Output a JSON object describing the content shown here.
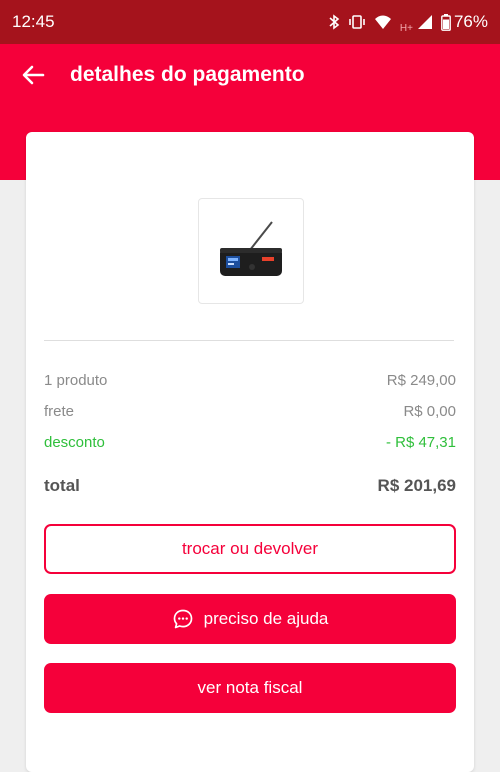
{
  "status_bar": {
    "time": "12:45",
    "network_label": "H+",
    "battery": "76%",
    "icons": [
      "bluetooth-icon",
      "vibrate-icon",
      "wifi-icon",
      "signal-icon",
      "battery-icon"
    ]
  },
  "header": {
    "back_icon": "arrow-left-icon",
    "title": "detalhes do pagamento"
  },
  "product": {
    "image": "portable-radio-speaker"
  },
  "summary": {
    "rows": [
      {
        "label": "1 produto",
        "value": "R$ 249,00"
      },
      {
        "label": "frete",
        "value": "R$ 0,00"
      },
      {
        "label": "desconto",
        "value": "- R$ 47,31"
      }
    ],
    "total_label": "total",
    "total_value": "R$ 201,69"
  },
  "actions": {
    "exchange_label": "trocar ou devolver",
    "help_label": "preciso de ajuda",
    "help_icon": "chat-bubble-icon",
    "invoice_label": "ver nota fiscal"
  },
  "colors": {
    "status_bar": "#a5131c",
    "brand": "#f5003a",
    "discount": "#2fbf3b"
  }
}
